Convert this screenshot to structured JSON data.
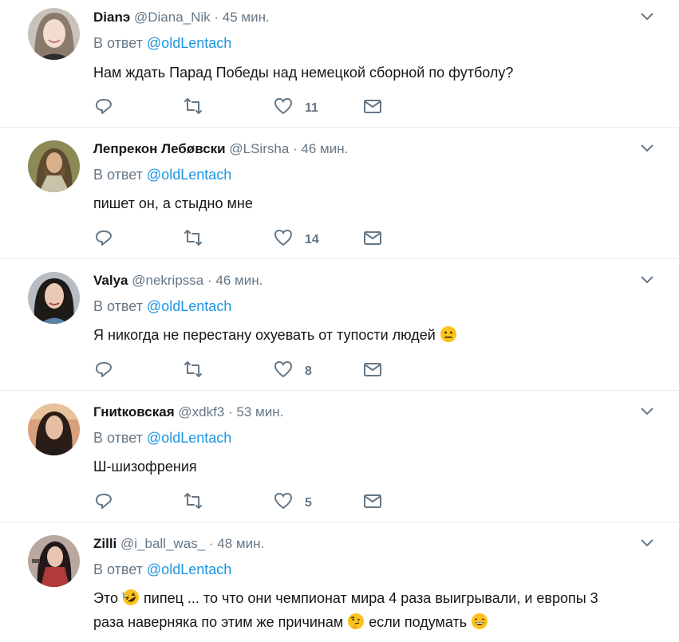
{
  "tweets": [
    {
      "name": "Dianэ",
      "handle": "@Diana_Nik",
      "time": "45 мин.",
      "reply_prefix": "В ответ",
      "reply_to": "@oldLentach",
      "text": "Нам ждать Парад Победы над немецкой сборной по футболу?",
      "likes": "11"
    },
    {
      "name": "Лепрекон Лебøвски",
      "handle": "@LSirsha",
      "time": "46 мин.",
      "reply_prefix": "В ответ",
      "reply_to": "@oldLentach",
      "text": "пишет он, а стыдно мне",
      "likes": "14"
    },
    {
      "name": "Valya",
      "handle": "@nekripssa",
      "time": "46 мин.",
      "reply_prefix": "В ответ",
      "reply_to": "@oldLentach",
      "text": "Я никогда не перестану охуевать от тупости людей",
      "text_emoji": "neutral-face",
      "likes": "8"
    },
    {
      "name": "Гниtковская",
      "handle": "@xdkf3",
      "time": "53 мин.",
      "reply_prefix": "В ответ",
      "reply_to": "@oldLentach",
      "text": "Ш-шизофрения",
      "likes": "5"
    },
    {
      "name": "Zilli",
      "handle": "@i_ball_was_",
      "time": "48 мин.",
      "reply_prefix": "В ответ",
      "reply_to": "@oldLentach",
      "text_parts": [
        "Это",
        "пипец ... то что они чемпионат мира 4 раза выигрывали, и европы 3",
        "раза наверняка по этим же причинам",
        "если подумать"
      ],
      "emojis": [
        "rolling-laughing-face",
        "thinking-face",
        "grinning-face"
      ]
    }
  ],
  "separator": "·",
  "colors": {
    "name": "#14171a",
    "secondary": "#657786",
    "mention": "#1b95e0",
    "divider": "#e6ecf0"
  }
}
